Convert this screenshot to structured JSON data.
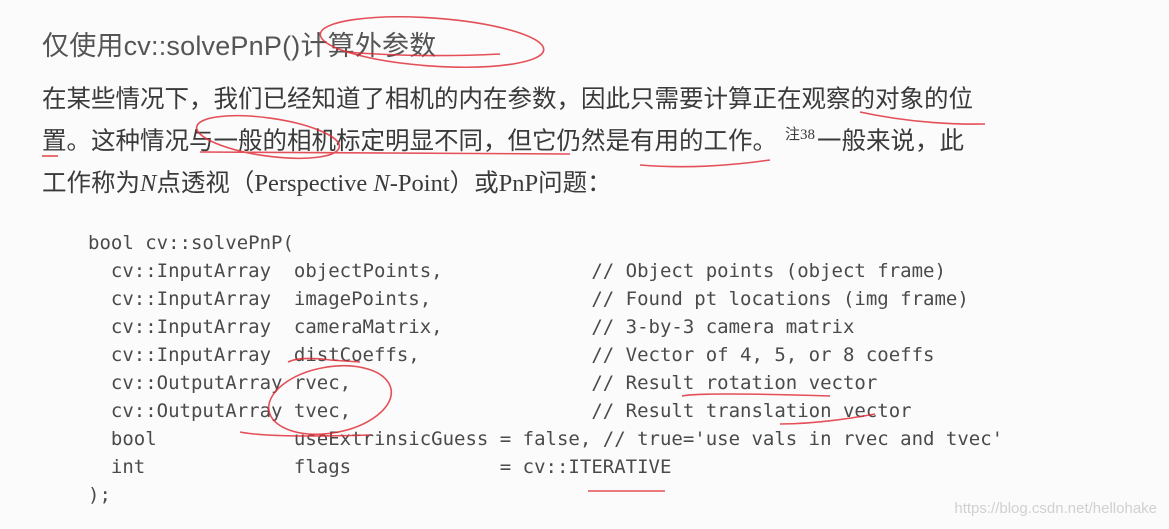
{
  "heading": "仅使用cv::solvePnP()计算外参数",
  "paragraph": {
    "line1": "在某些情况下，我们已经知道了相机的内在参数，因此只需要计算正在观察的对象的位",
    "line2_a": "置。这种情况与一般的相机标定明显不同，但它仍然是有用的工作。",
    "line2_note": "注38",
    "line2_b": "一般来说，此",
    "line3_a": "工作称为",
    "line3_n": "N",
    "line3_b": "点透视（Perspective ",
    "line3_n2": "N",
    "line3_c": "-Point）或PnP问题："
  },
  "code": {
    "lines": [
      "bool cv::solvePnP(",
      "  cv::InputArray  objectPoints,             // Object points (object frame)",
      "  cv::InputArray  imagePoints,              // Found pt locations (img frame)",
      "  cv::InputArray  cameraMatrix,             // 3-by-3 camera matrix",
      "  cv::InputArray  distCoeffs,               // Vector of 4, 5, or 8 coeffs",
      "  cv::OutputArray rvec,                     // Result rotation vector",
      "  cv::OutputArray tvec,                     // Result translation vector",
      "  bool            useExtrinsicGuess = false, // true='use vals in rvec and tvec'",
      "  int             flags             = cv::ITERATIVE",
      ");"
    ]
  },
  "annotation_color": "#e0303a",
  "watermark": "https://blog.csdn.net/hellohake"
}
